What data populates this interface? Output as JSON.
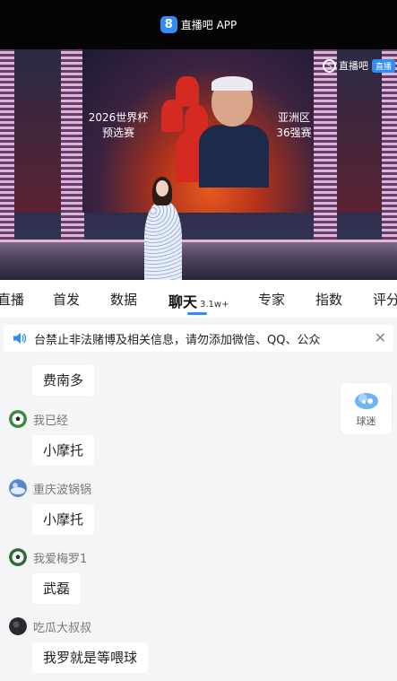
{
  "app": {
    "logo_glyph": "8",
    "name": "直播吧 APP",
    "accent": "#2f8df5"
  },
  "video": {
    "banner_left": [
      "2026世界杯",
      "预选赛"
    ],
    "banner_right": [
      "亚洲区",
      "36强赛"
    ],
    "watermark_text": "直播吧",
    "watermark_badge": "直播"
  },
  "tabs": [
    {
      "label": "直播"
    },
    {
      "label": "首发"
    },
    {
      "label": "数据"
    },
    {
      "label": "聊天",
      "badge": "3.1w+",
      "active": true
    },
    {
      "label": "专家"
    },
    {
      "label": "指数"
    },
    {
      "label": "评分"
    }
  ],
  "notice": {
    "icon": "speaker-icon",
    "text": "台禁止非法赌博及相关信息，请勿添加微信、QQ、公众"
  },
  "fans_button": {
    "icon": "fans-cloud-icon",
    "label": "球迷"
  },
  "chat": [
    {
      "user": "",
      "text": "费南多"
    },
    {
      "user": "我已经",
      "avatar": "soccer-ball-avatar",
      "text": "小摩托"
    },
    {
      "user": "重庆波锅锅",
      "avatar": "blue-sky-avatar",
      "text": "小摩托"
    },
    {
      "user": "我爱梅罗1",
      "avatar": "soccer-ball-avatar",
      "text": "武磊"
    },
    {
      "user": "吃瓜大叔叔",
      "avatar": "dark-avatar",
      "text": "我罗就是等喂球"
    }
  ]
}
